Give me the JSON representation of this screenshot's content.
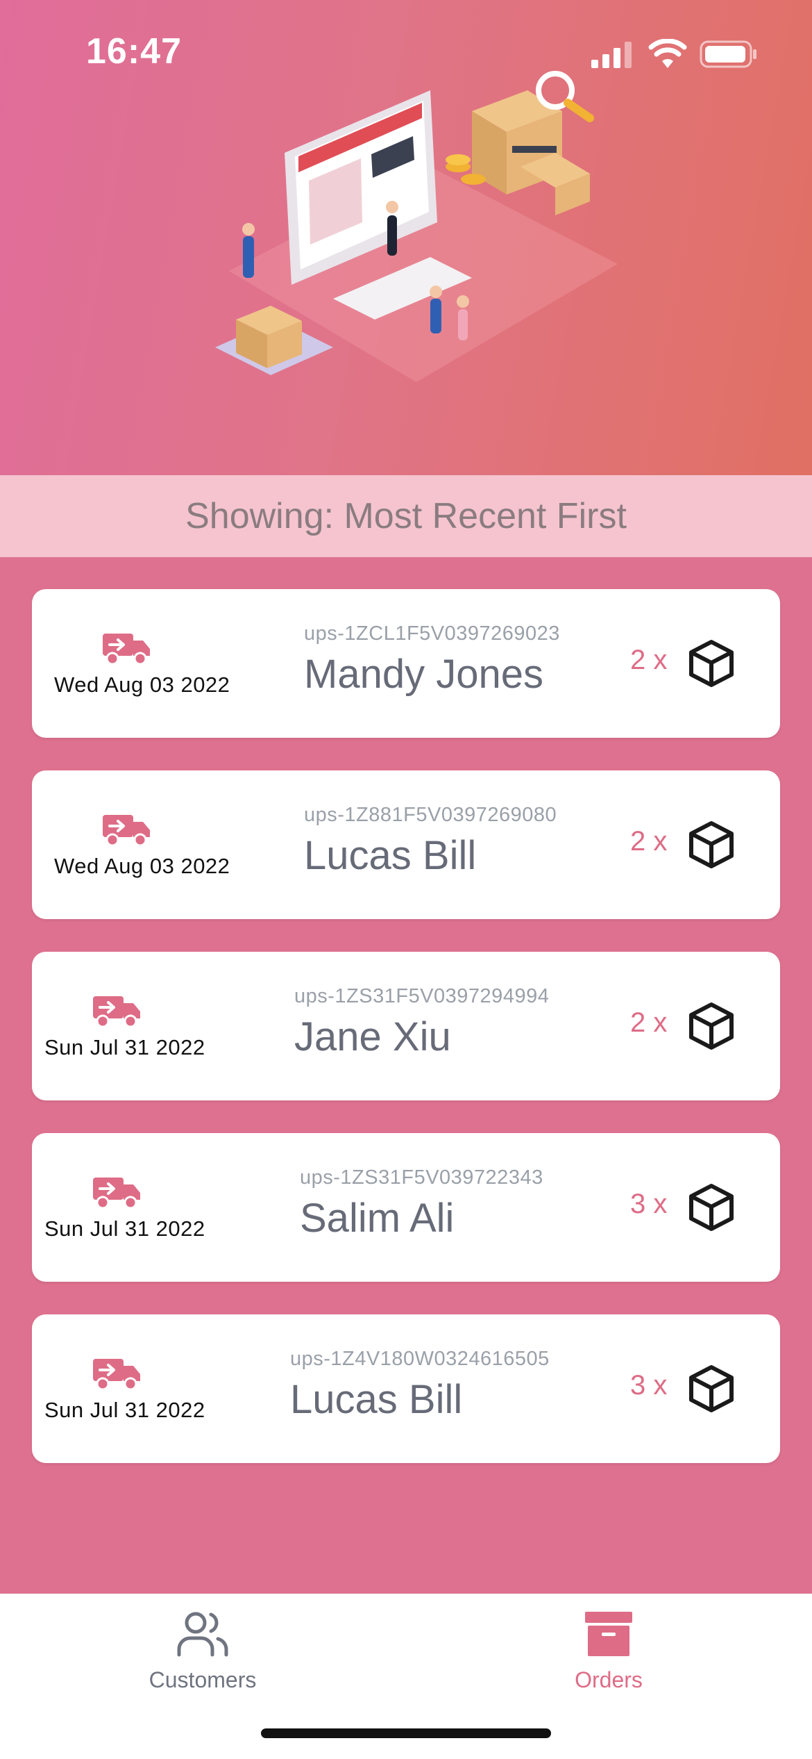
{
  "status_bar": {
    "time": "16:47"
  },
  "sort_bar": {
    "label": "Showing: Most Recent First"
  },
  "orders": [
    {
      "date": "Wed Aug 03 2022",
      "tracking": "ups-1ZCL1F5V0397269023",
      "name": "Mandy Jones",
      "quantity": "2 x"
    },
    {
      "date": "Wed Aug 03 2022",
      "tracking": "ups-1Z881F5V0397269080",
      "name": "Lucas Bill",
      "quantity": "2 x"
    },
    {
      "date": "Sun Jul 31 2022",
      "tracking": "ups-1ZS31F5V0397294994",
      "name": "Jane Xiu",
      "quantity": "2 x"
    },
    {
      "date": "Sun Jul 31 2022",
      "tracking": "ups-1ZS31F5V039722343",
      "name": "Salim Ali",
      "quantity": "3 x"
    },
    {
      "date": "Sun Jul 31 2022",
      "tracking": "ups-1Z4V180W0324616505",
      "name": "Lucas Bill",
      "quantity": "3 x"
    }
  ],
  "tabs": [
    {
      "label": "Customers",
      "icon": "users-icon",
      "active": false
    },
    {
      "label": "Orders",
      "icon": "archive-box-icon",
      "active": true
    }
  ],
  "colors": {
    "accent": "#de6c86",
    "background": "#de7190",
    "sort_bar": "#f5c4cf",
    "card": "#ffffff"
  }
}
